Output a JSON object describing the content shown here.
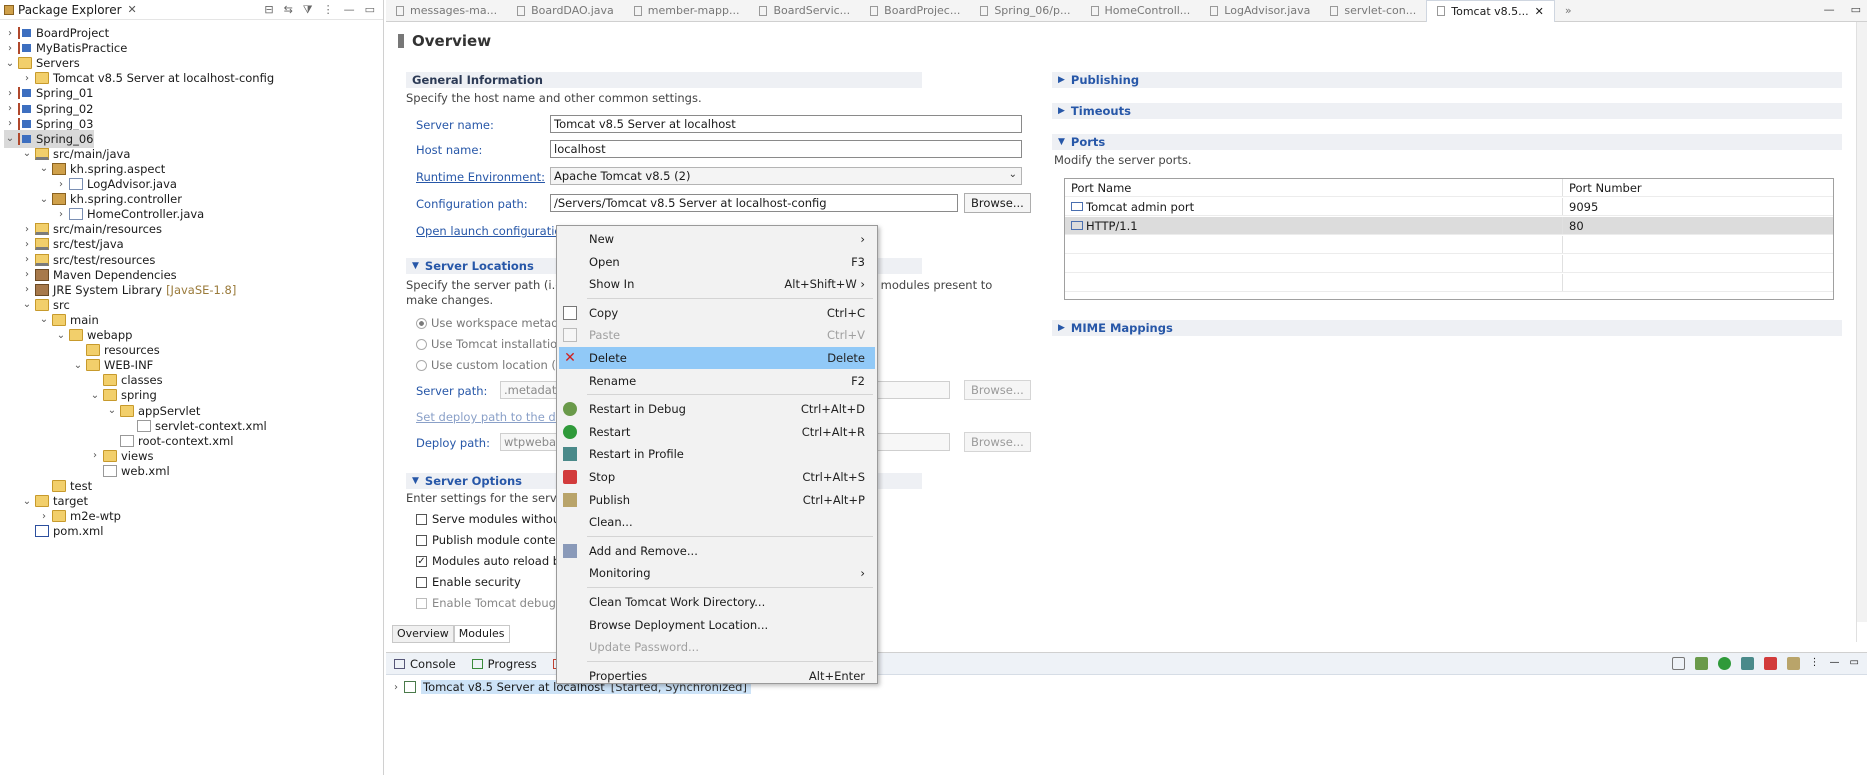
{
  "package_explorer": {
    "title": "Package Explorer",
    "tree": [
      {
        "label": "BoardProject",
        "depth": 0,
        "twisty": ">",
        "icon": "project-icon"
      },
      {
        "label": "MyBatisPractice",
        "depth": 0,
        "twisty": ">",
        "icon": "project-icon"
      },
      {
        "label": "Servers",
        "depth": 0,
        "twisty": "v",
        "icon": "folder-icon"
      },
      {
        "label": "Tomcat v8.5 Server at localhost-config",
        "depth": 1,
        "twisty": ">",
        "icon": "folder-icon"
      },
      {
        "label": "Spring_01",
        "depth": 0,
        "twisty": ">",
        "icon": "project-icon"
      },
      {
        "label": "Spring_02",
        "depth": 0,
        "twisty": ">",
        "icon": "project-icon"
      },
      {
        "label": "Spring_03",
        "depth": 0,
        "twisty": ">",
        "icon": "project-icon"
      },
      {
        "label": "Spring_06",
        "depth": 0,
        "twisty": "v",
        "icon": "project-icon",
        "selected": true
      },
      {
        "label": "src/main/java",
        "depth": 1,
        "twisty": "v",
        "icon": "source-folder-icon"
      },
      {
        "label": "kh.spring.aspect",
        "depth": 2,
        "twisty": "v",
        "icon": "package-icon"
      },
      {
        "label": "LogAdvisor.java",
        "depth": 3,
        "twisty": ">",
        "icon": "java-file-icon"
      },
      {
        "label": "kh.spring.controller",
        "depth": 2,
        "twisty": "v",
        "icon": "package-icon"
      },
      {
        "label": "HomeController.java",
        "depth": 3,
        "twisty": ">",
        "icon": "java-file-icon"
      },
      {
        "label": "src/main/resources",
        "depth": 1,
        "twisty": ">",
        "icon": "source-folder-icon"
      },
      {
        "label": "src/test/java",
        "depth": 1,
        "twisty": ">",
        "icon": "source-folder-icon"
      },
      {
        "label": "src/test/resources",
        "depth": 1,
        "twisty": ">",
        "icon": "source-folder-icon"
      },
      {
        "label": "Maven Dependencies",
        "depth": 1,
        "twisty": ">",
        "icon": "library-icon"
      },
      {
        "label": "JRE System Library",
        "suffix": "[JavaSE-1.8]",
        "depth": 1,
        "twisty": ">",
        "icon": "library-icon"
      },
      {
        "label": "src",
        "depth": 1,
        "twisty": "v",
        "icon": "folder-icon"
      },
      {
        "label": "main",
        "depth": 2,
        "twisty": "v",
        "icon": "folder-icon"
      },
      {
        "label": "webapp",
        "depth": 3,
        "twisty": "v",
        "icon": "folder-icon"
      },
      {
        "label": "resources",
        "depth": 4,
        "twisty": "",
        "icon": "folder-icon"
      },
      {
        "label": "WEB-INF",
        "depth": 4,
        "twisty": "v",
        "icon": "folder-icon"
      },
      {
        "label": "classes",
        "depth": 5,
        "twisty": "",
        "icon": "folder-icon"
      },
      {
        "label": "spring",
        "depth": 5,
        "twisty": "v",
        "icon": "folder-icon"
      },
      {
        "label": "appServlet",
        "depth": 6,
        "twisty": "v",
        "icon": "folder-icon"
      },
      {
        "label": "servlet-context.xml",
        "depth": 7,
        "twisty": "",
        "icon": "xml-file-icon"
      },
      {
        "label": "root-context.xml",
        "depth": 6,
        "twisty": "",
        "icon": "xml-file-icon"
      },
      {
        "label": "views",
        "depth": 5,
        "twisty": ">",
        "icon": "folder-icon"
      },
      {
        "label": "web.xml",
        "depth": 5,
        "twisty": "",
        "icon": "xml-file-icon"
      },
      {
        "label": "test",
        "depth": 2,
        "twisty": "",
        "icon": "folder-icon"
      },
      {
        "label": "target",
        "depth": 1,
        "twisty": "v",
        "icon": "folder-icon"
      },
      {
        "label": "m2e-wtp",
        "depth": 2,
        "twisty": ">",
        "icon": "folder-icon"
      },
      {
        "label": "pom.xml",
        "depth": 1,
        "twisty": "",
        "icon": "maven-file-icon"
      }
    ]
  },
  "editor_tabs": [
    {
      "label": "messages-ma..."
    },
    {
      "label": "BoardDAO.java"
    },
    {
      "label": "member-mapp..."
    },
    {
      "label": "BoardServic..."
    },
    {
      "label": "BoardProjec..."
    },
    {
      "label": "Spring_06/p..."
    },
    {
      "label": "HomeControll..."
    },
    {
      "label": "LogAdvisor.java"
    },
    {
      "label": "servlet-con..."
    },
    {
      "label": "Tomcat v8.5...",
      "active": true
    }
  ],
  "tab_overflow": "»",
  "overview": {
    "title": "Overview",
    "general": {
      "heading": "General Information",
      "desc": "Specify the host name and other common settings.",
      "server_name_label": "Server name:",
      "server_name_value": "Tomcat v8.5 Server at localhost",
      "host_name_label": "Host name:",
      "host_name_value": "localhost",
      "runtime_label": "Runtime Environment:",
      "runtime_value": "Apache Tomcat v8.5 (2)",
      "config_label": "Configuration path:",
      "config_value": "/Servers/Tomcat v8.5 Server at localhost-config",
      "browse": "Browse...",
      "open_launch": "Open launch configuratio"
    },
    "locations": {
      "heading": "Server Locations",
      "desc1": "Specify the server path (i.e.",
      "desc1_tail": "ith no modules present to",
      "desc2": "make changes.",
      "radio1": "Use workspace metada",
      "radio2": "Use Tomcat installatio",
      "radio3": "Use custom location (",
      "server_path_label": "Server path:",
      "server_path_value": ".metadat",
      "set_deploy": "Set deploy path to the de",
      "deploy_path_label": "Deploy path:",
      "deploy_path_value": "wtpweba",
      "browse": "Browse..."
    },
    "options": {
      "heading": "Server Options",
      "desc": "Enter settings for the server",
      "opt1": "Serve modules without",
      "opt2": "Publish module contex",
      "opt3": "Modules auto reload b",
      "opt4": "Enable security",
      "opt5": "Enable Tomcat debug"
    },
    "right": {
      "publishing": "Publishing",
      "timeouts": "Timeouts",
      "ports": "Ports",
      "ports_desc": "Modify the server ports.",
      "col_name": "Port Name",
      "col_number": "Port Number",
      "rows": [
        {
          "name": "Tomcat admin port",
          "number": "9095"
        },
        {
          "name": "HTTP/1.1",
          "number": "80"
        }
      ],
      "mime": "MIME Mappings"
    },
    "bottom_tabs": [
      "Overview",
      "Modules"
    ]
  },
  "console": {
    "tabs": [
      "Console",
      "Progress"
    ],
    "server_label": "Tomcat v8.5 Server at localhost",
    "server_state": "[Started, Synchronized]"
  },
  "context_menu": [
    {
      "label": "New",
      "shortcut": "",
      "submenu": true,
      "icon": ""
    },
    {
      "label": "Open",
      "shortcut": "F3",
      "icon": ""
    },
    {
      "label": "Show In",
      "shortcut": "Alt+Shift+W",
      "submenu": true,
      "icon": ""
    },
    {
      "sep": true
    },
    {
      "label": "Copy",
      "shortcut": "Ctrl+C",
      "icon": "copy-icon"
    },
    {
      "label": "Paste",
      "shortcut": "Ctrl+V",
      "icon": "paste-icon",
      "disabled": true
    },
    {
      "label": "Delete",
      "shortcut": "Delete",
      "icon": "delete-icon",
      "hover": true
    },
    {
      "label": "Rename",
      "shortcut": "F2",
      "icon": ""
    },
    {
      "sep": true
    },
    {
      "label": "Restart in Debug",
      "shortcut": "Ctrl+Alt+D",
      "icon": "debug-icon"
    },
    {
      "label": "Restart",
      "shortcut": "Ctrl+Alt+R",
      "icon": "run-icon"
    },
    {
      "label": "Restart in Profile",
      "shortcut": "",
      "icon": "profile-icon"
    },
    {
      "label": "Stop",
      "shortcut": "Ctrl+Alt+S",
      "icon": "stop-icon"
    },
    {
      "label": "Publish",
      "shortcut": "Ctrl+Alt+P",
      "icon": "publish-icon"
    },
    {
      "label": "Clean...",
      "shortcut": "",
      "icon": ""
    },
    {
      "sep": true
    },
    {
      "label": "Add and Remove...",
      "shortcut": "",
      "icon": "add-remove-icon"
    },
    {
      "label": "Monitoring",
      "shortcut": "",
      "submenu": true,
      "icon": ""
    },
    {
      "sep": true
    },
    {
      "label": "Clean Tomcat Work Directory...",
      "shortcut": "",
      "icon": ""
    },
    {
      "label": "Browse Deployment Location...",
      "shortcut": "",
      "icon": ""
    },
    {
      "label": "Update Password...",
      "shortcut": "",
      "icon": "",
      "disabled": true
    },
    {
      "sep": true
    },
    {
      "label": "Properties",
      "shortcut": "Alt+Enter",
      "icon": ""
    }
  ],
  "colors": {
    "selection": "#91c9f7",
    "link": "#2757a8"
  }
}
